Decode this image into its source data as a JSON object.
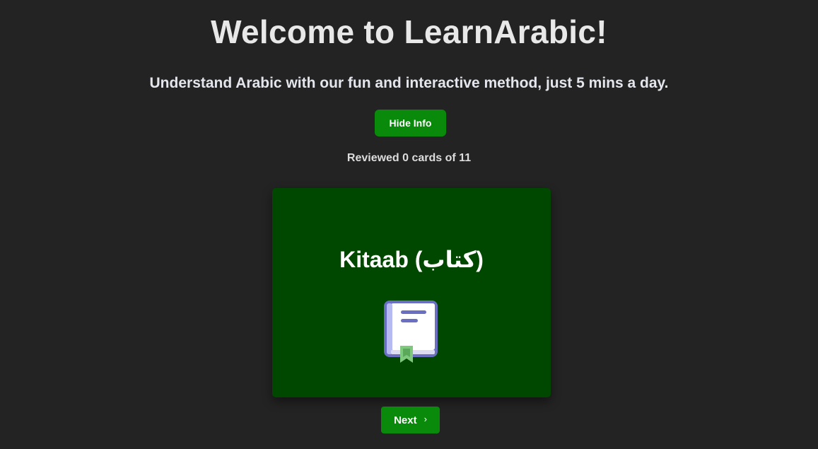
{
  "header": {
    "title": "Welcome to LearnArabic!",
    "subtitle": "Understand Arabic with our fun and interactive method, just 5 mins a day."
  },
  "controls": {
    "hide_info_label": "Hide Info",
    "next_label": "Next",
    "next_icon": "chevron-right-icon"
  },
  "progress": {
    "text": "Reviewed 0 cards of 11",
    "reviewed": 0,
    "total": 11
  },
  "card": {
    "word": "Kitaab (كتاب)",
    "icon": "book-icon"
  },
  "colors": {
    "background": "#232323",
    "button_green": "#0a8a0a",
    "card_green": "#004700",
    "book_purple": "#6a6fc2",
    "bookmark_green": "#7fc97f"
  }
}
